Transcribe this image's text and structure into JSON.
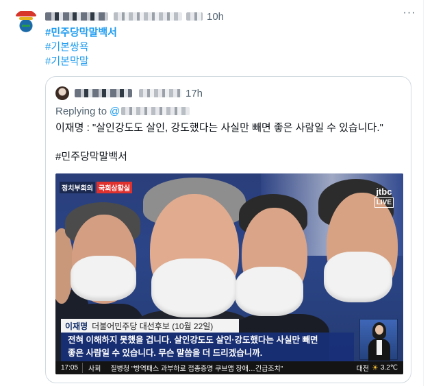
{
  "tweet": {
    "time": "10h",
    "more_label": "···",
    "hashtags": [
      "#민주당막말백서",
      "#기본쌍욕",
      "#기본막말"
    ]
  },
  "quote": {
    "time": "17h",
    "replying_label": "Replying to",
    "replying_handle": "@",
    "text": "이재명 : \"살인강도도 살인, 강도했다는 사실만 빼면 좋은 사람일 수 있습니다.\"",
    "hashtag": "#민주당막말백서"
  },
  "media": {
    "top_caption_a": "정치부회의",
    "top_caption_b": "국회상황실",
    "channel": "jtbc",
    "live_label": "LIVE",
    "name_tag": "이재명",
    "name_detail": "더불어민주당 대선후보 (10월 22일)",
    "subtitle_line1": "전혀 이해하지 못했을 겁니다. 살인강도도 살인·강도했다는 사실만 빼면",
    "subtitle_line2": "좋은 사람일 수 있습니다. 무슨 말씀을 더 드리겠습니까.",
    "ticker_time": "17:05",
    "ticker_section": "사회",
    "ticker_news": "질병청 \"방역패스 과부하로 접종증명 쿠브앱 장애…긴급조치\"",
    "ticker_city": "대전",
    "ticker_weather_icon": "sun-icon",
    "ticker_temp": "3.2℃"
  },
  "colors": {
    "link": "#1d9bf0",
    "muted": "#536471",
    "border": "#cfd9de",
    "subtitle_bg": "#18307a"
  }
}
